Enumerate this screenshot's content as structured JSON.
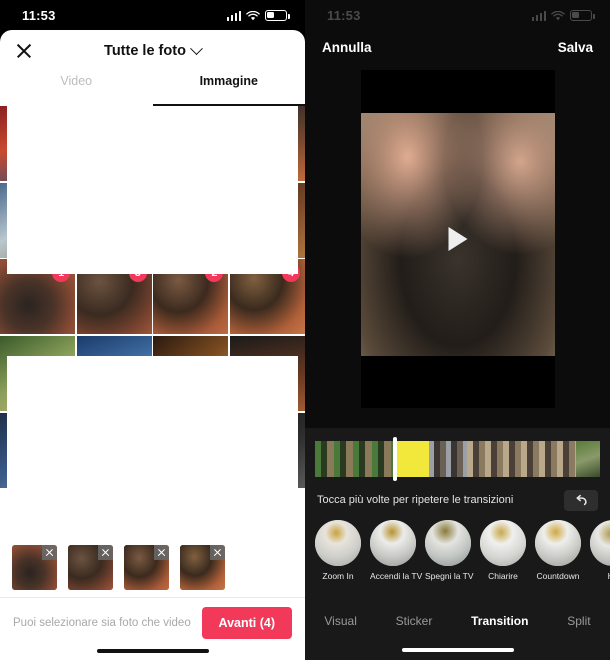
{
  "left": {
    "status": {
      "time": "11:53"
    },
    "sheet": {
      "close_icon": "close-icon",
      "album_title": "Tutte le foto",
      "chevron_icon": "chevron-down-icon",
      "tabs": [
        {
          "label": "Video",
          "active": false
        },
        {
          "label": "Immagine",
          "active": true
        }
      ]
    },
    "grid": {
      "selected_row": [
        {
          "badge": "1"
        },
        {
          "badge": "3"
        },
        {
          "badge": "2"
        },
        {
          "badge": "4"
        }
      ]
    },
    "tray": {
      "remove_icon": "close-icon",
      "items": [
        {
          "name": "selected-photo-1"
        },
        {
          "name": "selected-photo-2"
        },
        {
          "name": "selected-photo-3"
        },
        {
          "name": "selected-photo-4"
        }
      ]
    },
    "footer": {
      "hint": "Puoi selezionare sia foto che video",
      "next_label": "Avanti (4)",
      "next_color": "#f2395a"
    }
  },
  "right": {
    "status": {
      "time": "11:53"
    },
    "editbar": {
      "cancel": "Annulla",
      "save": "Salva"
    },
    "preview": {
      "play_icon": "play-icon"
    },
    "timeline": {
      "playhead_icon": "playhead-handle"
    },
    "hint": {
      "text": "Tocca più volte per ripetere le transizioni",
      "undo_icon": "undo-icon"
    },
    "transitions": [
      {
        "label": "Zoom In"
      },
      {
        "label": "Accendi la TV"
      },
      {
        "label": "Spegni la TV"
      },
      {
        "label": "Chiarire"
      },
      {
        "label": "Countdown"
      },
      {
        "label": "Ho"
      }
    ],
    "tabs": [
      {
        "label": "Visual",
        "active": false
      },
      {
        "label": "Sticker",
        "active": false
      },
      {
        "label": "Transition",
        "active": true
      },
      {
        "label": "Split",
        "active": false
      }
    ]
  }
}
